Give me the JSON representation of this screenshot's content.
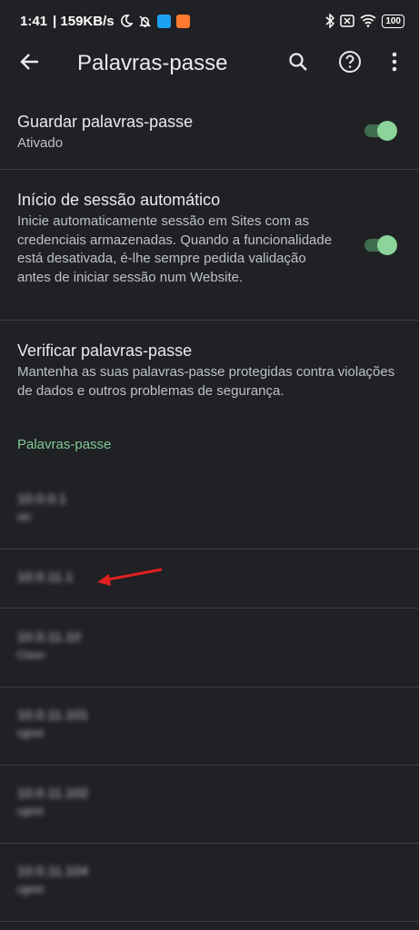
{
  "status_bar": {
    "time": "1:41",
    "speed": "| 159KB/s",
    "battery": "100"
  },
  "app_bar": {
    "title": "Palavras-passe",
    "icons": [
      "back-arrow-icon",
      "search-icon",
      "help-icon",
      "more-vert-icon"
    ]
  },
  "settings": [
    {
      "title": "Guardar palavras-passe",
      "subtitle": "Ativado",
      "toggle_on": true
    },
    {
      "title": "Início de sessão automático",
      "subtitle": "Inicie automaticamente sessão em Sites com as credenciais armazenadas. Quando a funcionalidade está desativada, é-lhe sempre pedida validação antes de iniciar sessão num Website.",
      "toggle_on": true
    },
    {
      "title": "Verificar palavras-passe",
      "subtitle": "Mantenha as suas palavras-passe protegidas contra violações de dados e outros problemas de segurança."
    }
  ],
  "section_header": "Palavras-passe",
  "passwords": [
    {
      "host": "10.0.0.1",
      "user": "sin"
    },
    {
      "host": "10.0.11.1",
      "user": ""
    },
    {
      "host": "10.0.11.10",
      "user": "Cisco"
    },
    {
      "host": "10.0.11.101",
      "user": "cgnvt"
    },
    {
      "host": "10.0.11.102",
      "user": "cgnvt"
    },
    {
      "host": "10.0.11.104",
      "user": "cgnvt"
    }
  ],
  "colors": {
    "background": "#202124",
    "accent_green": "#81c995",
    "toggle_thumb": "#8bd49a",
    "annotation_arrow": "#e02020"
  }
}
